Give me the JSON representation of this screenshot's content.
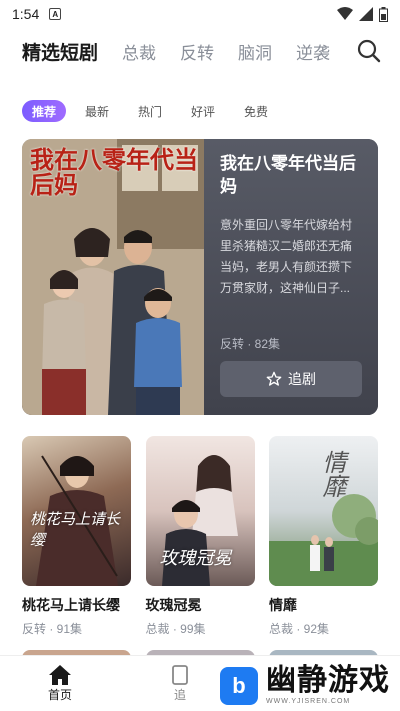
{
  "status_bar": {
    "time": "1:54",
    "notification_badge": "A"
  },
  "top_tabs": [
    {
      "label": "精选短剧",
      "active": true
    },
    {
      "label": "总裁",
      "active": false
    },
    {
      "label": "反转",
      "active": false
    },
    {
      "label": "脑洞",
      "active": false
    },
    {
      "label": "逆袭",
      "active": false
    }
  ],
  "filter_chips": [
    {
      "label": "推荐",
      "active": true
    },
    {
      "label": "最新",
      "active": false
    },
    {
      "label": "热门",
      "active": false
    },
    {
      "label": "好评",
      "active": false
    },
    {
      "label": "免费",
      "active": false
    }
  ],
  "featured": {
    "poster_title": "我在八零年代当后妈",
    "title": "我在八零年代当后妈",
    "description": "意外重回八零年代嫁给村里杀猪糙汉二婚郎还无痛当妈，老男人有颜还攒下万贯家财，这神仙日子...",
    "meta": "反转 · 82集",
    "follow_label": "追剧"
  },
  "dramas": [
    {
      "name": "桃花马上请长缨",
      "meta": "反转 · 91集",
      "poster_text": "桃花马上请长缨"
    },
    {
      "name": "玫瑰冠冕",
      "meta": "总裁 · 99集",
      "poster_text": "玫瑰冠冕"
    },
    {
      "name": "情靡",
      "meta": "总裁 · 92集",
      "poster_text": "情靡"
    }
  ],
  "bottom_nav": [
    {
      "label": "首页",
      "active": true
    },
    {
      "label": "追",
      "active": false
    }
  ],
  "watermark": {
    "logo_letter": "b",
    "brand": "幽静游戏",
    "url": "WWW.YJISREN.COM"
  },
  "colors": {
    "accent": "#8a63ff",
    "featured_bg": "#474a55",
    "muted_text": "#8a8f99"
  }
}
